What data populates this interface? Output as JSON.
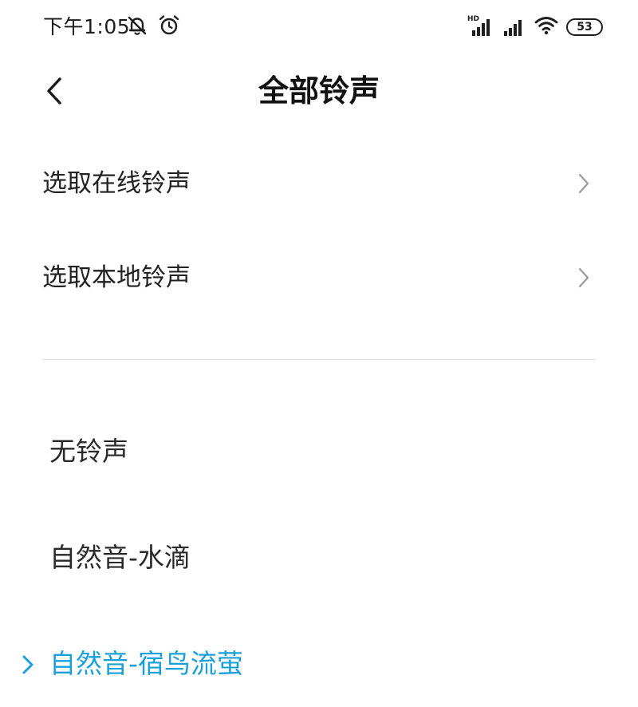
{
  "status_bar": {
    "time": "下午1:05",
    "hd_label": "HD",
    "battery": "53",
    "icons": [
      "bell-muted-icon",
      "alarm-icon",
      "signal-hd-icon",
      "signal-icon",
      "wifi-icon",
      "battery-icon"
    ]
  },
  "header": {
    "title": "全部铃声",
    "back_icon": "chevron-left-icon"
  },
  "options": [
    {
      "label": "选取在线铃声",
      "icon": "chevron-right-icon"
    },
    {
      "label": "选取本地铃声",
      "icon": "chevron-right-icon"
    }
  ],
  "ringtones": [
    {
      "label": "无铃声",
      "selected": false
    },
    {
      "label": "自然音-水滴",
      "selected": false
    },
    {
      "label": "自然音-宿鸟流萤",
      "selected": true
    }
  ],
  "colors": {
    "accent": "#1aa0d8",
    "text": "#222222",
    "divider": "#e2e2e2",
    "chevron": "#9a9a9a"
  }
}
